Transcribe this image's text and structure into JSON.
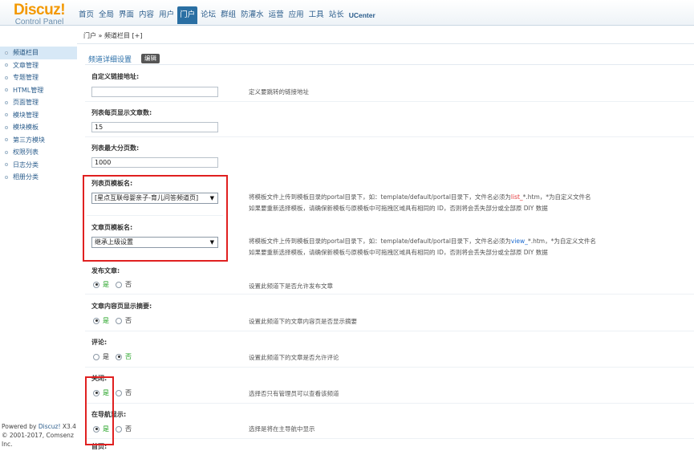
{
  "logo": {
    "brand": "Discuz",
    "bang": "!",
    "sub": "Control Panel"
  },
  "topnav": [
    "首页",
    "全局",
    "界面",
    "内容",
    "用户",
    "门户",
    "论坛",
    "群组",
    "防灌水",
    "运营",
    "应用",
    "工具",
    "站长",
    "UCenter"
  ],
  "topnav_active_index": 5,
  "breadcrumb": "门户 » 频道栏目 [+]",
  "sidebar": {
    "items": [
      "频道栏目",
      "文章管理",
      "专题管理",
      "HTML管理",
      "页面管理",
      "模块管理",
      "模块模板",
      "第三方模块",
      "权限列表",
      "日志分类",
      "相册分类"
    ],
    "active_index": 0,
    "footer_powered": "Powered by ",
    "footer_link": "Discuz!",
    "footer_version": " X3.4",
    "footer_copyright": "© 2001-2017, Comsenz Inc."
  },
  "main": {
    "title": "频道详细设置",
    "edit_button": "编辑",
    "custom_link": {
      "label": "自定义链接地址:",
      "value": "",
      "tip": "定义要跳转的链接地址"
    },
    "per_page": {
      "label": "列表每页显示文章数:",
      "value": "15"
    },
    "max_pages": {
      "label": "列表最大分页数:",
      "value": "1000"
    },
    "list_template": {
      "label": "列表页模板名:",
      "selected": "[星点互联母婴亲子-育儿问答频道页]",
      "tip1_a": "将模板文件上传到模板目录的portal目录下，如：template/default/portal目录下，文件名必须为",
      "tip1_hl": "list_",
      "tip1_b": "*.htm，*为自定义文件名",
      "tip2": "如果要重新选择模板，请确保新模板与原模板中可拖拽区域具有相同的 ID，否则将会丢失部分或全部原 DIY 数据"
    },
    "article_template": {
      "label": "文章页模板名:",
      "selected": "继承上级设置",
      "tip1_a": "将模板文件上传到模板目录的portal目录下，如：template/default/portal目录下，文件名必须为",
      "tip1_hl": "view_",
      "tip1_b": "*.htm，*为自定义文件名",
      "tip2": "如果要重新选择模板，请确保新模板与原模板中可拖拽区域具有相同的 ID，否则将会丢失部分或全部原 DIY 数据"
    },
    "publish": {
      "label": "发布文章:",
      "yes": "是",
      "no": "否",
      "value": "yes",
      "tip": "设置此频道下是否允许发布文章"
    },
    "summary": {
      "label": "文章内容页显示摘要:",
      "yes": "是",
      "no": "否",
      "value": "yes",
      "tip": "设置此频道下的文章内容页是否显示摘要"
    },
    "comment": {
      "label": "评论:",
      "yes": "是",
      "no": "否",
      "value": "no",
      "tip": "设置此频道下的文章是否允许评论"
    },
    "closed": {
      "label": "关闭:",
      "yes": "是",
      "no": "否",
      "value": "yes",
      "tip": "选择否只有管理员可以查看该频道"
    },
    "nav_display": {
      "label": "在导航显示:",
      "yes": "是",
      "no": "否",
      "value": "yes",
      "tip": "选择是将在主导航中显示"
    },
    "homepage_label": "首页:"
  },
  "colors": {
    "highlight_red": "#e02020",
    "active_nav": "#2a6fa3",
    "link_blue": "#2b5d8c",
    "yes_green": "#1fa01f"
  }
}
